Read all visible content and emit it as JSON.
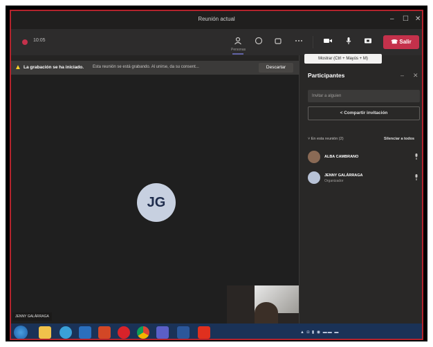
{
  "window": {
    "title": "Reunión actual",
    "controls": {
      "minimize": "–",
      "maximize": "☐",
      "close": "✕"
    }
  },
  "toolbar": {
    "timer": "10:05",
    "participants_sub": "Personas",
    "leave_label": "Salir",
    "icons": [
      "participants-icon",
      "chat-icon",
      "reactions-icon",
      "more-icon",
      "camera-icon",
      "mic-icon",
      "share-icon",
      "phone-hangup-icon"
    ],
    "accent": "#c4314b"
  },
  "tooltip": "Mostrar (Ctrl + Mayús + M)",
  "banner": {
    "bold_text": "La grabación se ha iniciado.",
    "text": "Esta reunión se está grabando. Al unirse, da su consent...",
    "dismiss_label": "Descartar"
  },
  "stage": {
    "avatar_initials": "JG",
    "name_tag": "JENNY GALÁRRAGA"
  },
  "panel": {
    "title": "Participantes",
    "search_placeholder": "Invitar a alguien",
    "share_label": "Compartir invitación",
    "section_header": "En esta reunión (2)",
    "mute_all_label": "Silenciar a todos",
    "participants": [
      {
        "name": "ALBA CAMBRANO",
        "role": ""
      },
      {
        "name": "JENNY GALÁRRAGA",
        "role": "Organizador"
      }
    ]
  },
  "taskbar": {
    "apps": [
      "start-icon",
      "file-explorer-icon",
      "edge-icon",
      "store-icon",
      "powerpoint-icon",
      "opera-icon",
      "chrome-icon",
      "teams-icon",
      "word-icon",
      "acrobat-icon"
    ],
    "color": "#1a3257"
  }
}
